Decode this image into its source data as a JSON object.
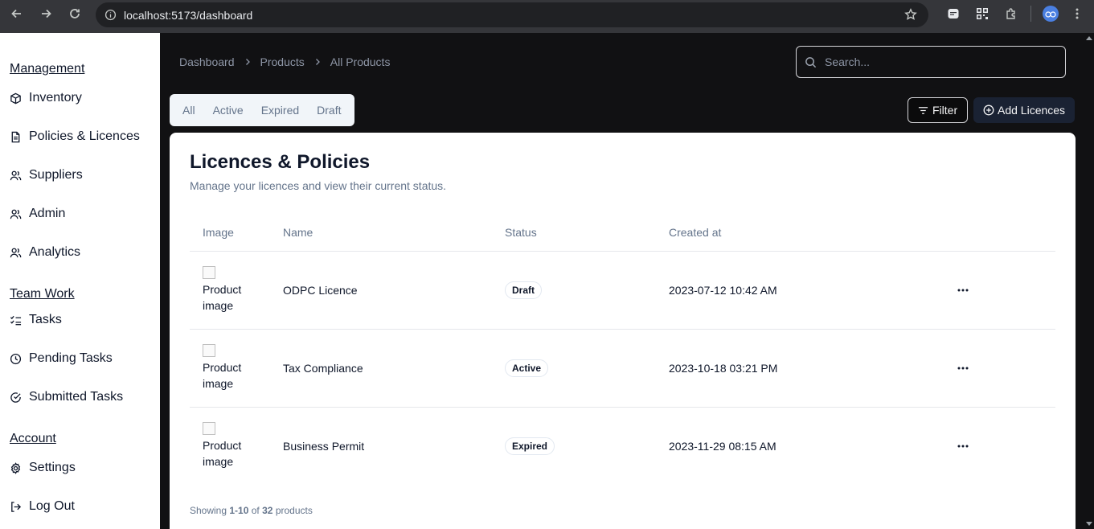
{
  "browser": {
    "url": "localhost:5173/dashboard"
  },
  "sidebar": {
    "sections": {
      "management": "Management",
      "team_work": "Team Work",
      "account": "Account"
    },
    "items": {
      "inventory": "Inventory",
      "policies": "Policies & Licences",
      "suppliers": "Suppliers",
      "admin": "Admin",
      "analytics": "Analytics",
      "tasks": "Tasks",
      "pending_tasks": "Pending Tasks",
      "submitted_tasks": "Submitted Tasks",
      "settings": "Settings",
      "logout": "Log Out"
    }
  },
  "breadcrumb": [
    "Dashboard",
    "Products",
    "All Products"
  ],
  "search": {
    "placeholder": "Search..."
  },
  "tabs": [
    "All",
    "Active",
    "Expired",
    "Draft"
  ],
  "actions": {
    "filter": "Filter",
    "add": "Add Licences"
  },
  "card": {
    "title": "Licences & Policies",
    "subtitle": "Manage your licences and view their current status.",
    "columns": {
      "image": "Image",
      "name": "Name",
      "status": "Status",
      "created_at": "Created at"
    },
    "rows": [
      {
        "image_alt": "Product image",
        "name": "ODPC Licence",
        "status": "Draft",
        "created_at": "2023-07-12 10:42 AM"
      },
      {
        "image_alt": "Product image",
        "name": "Tax Compliance",
        "status": "Active",
        "created_at": "2023-10-18 03:21 PM"
      },
      {
        "image_alt": "Product image",
        "name": "Business Permit",
        "status": "Expired",
        "created_at": "2023-11-29 08:15 AM"
      }
    ],
    "footer": {
      "prefix": "Showing",
      "range": "1-10",
      "of": "of",
      "total": "32",
      "suffix": "products"
    }
  }
}
